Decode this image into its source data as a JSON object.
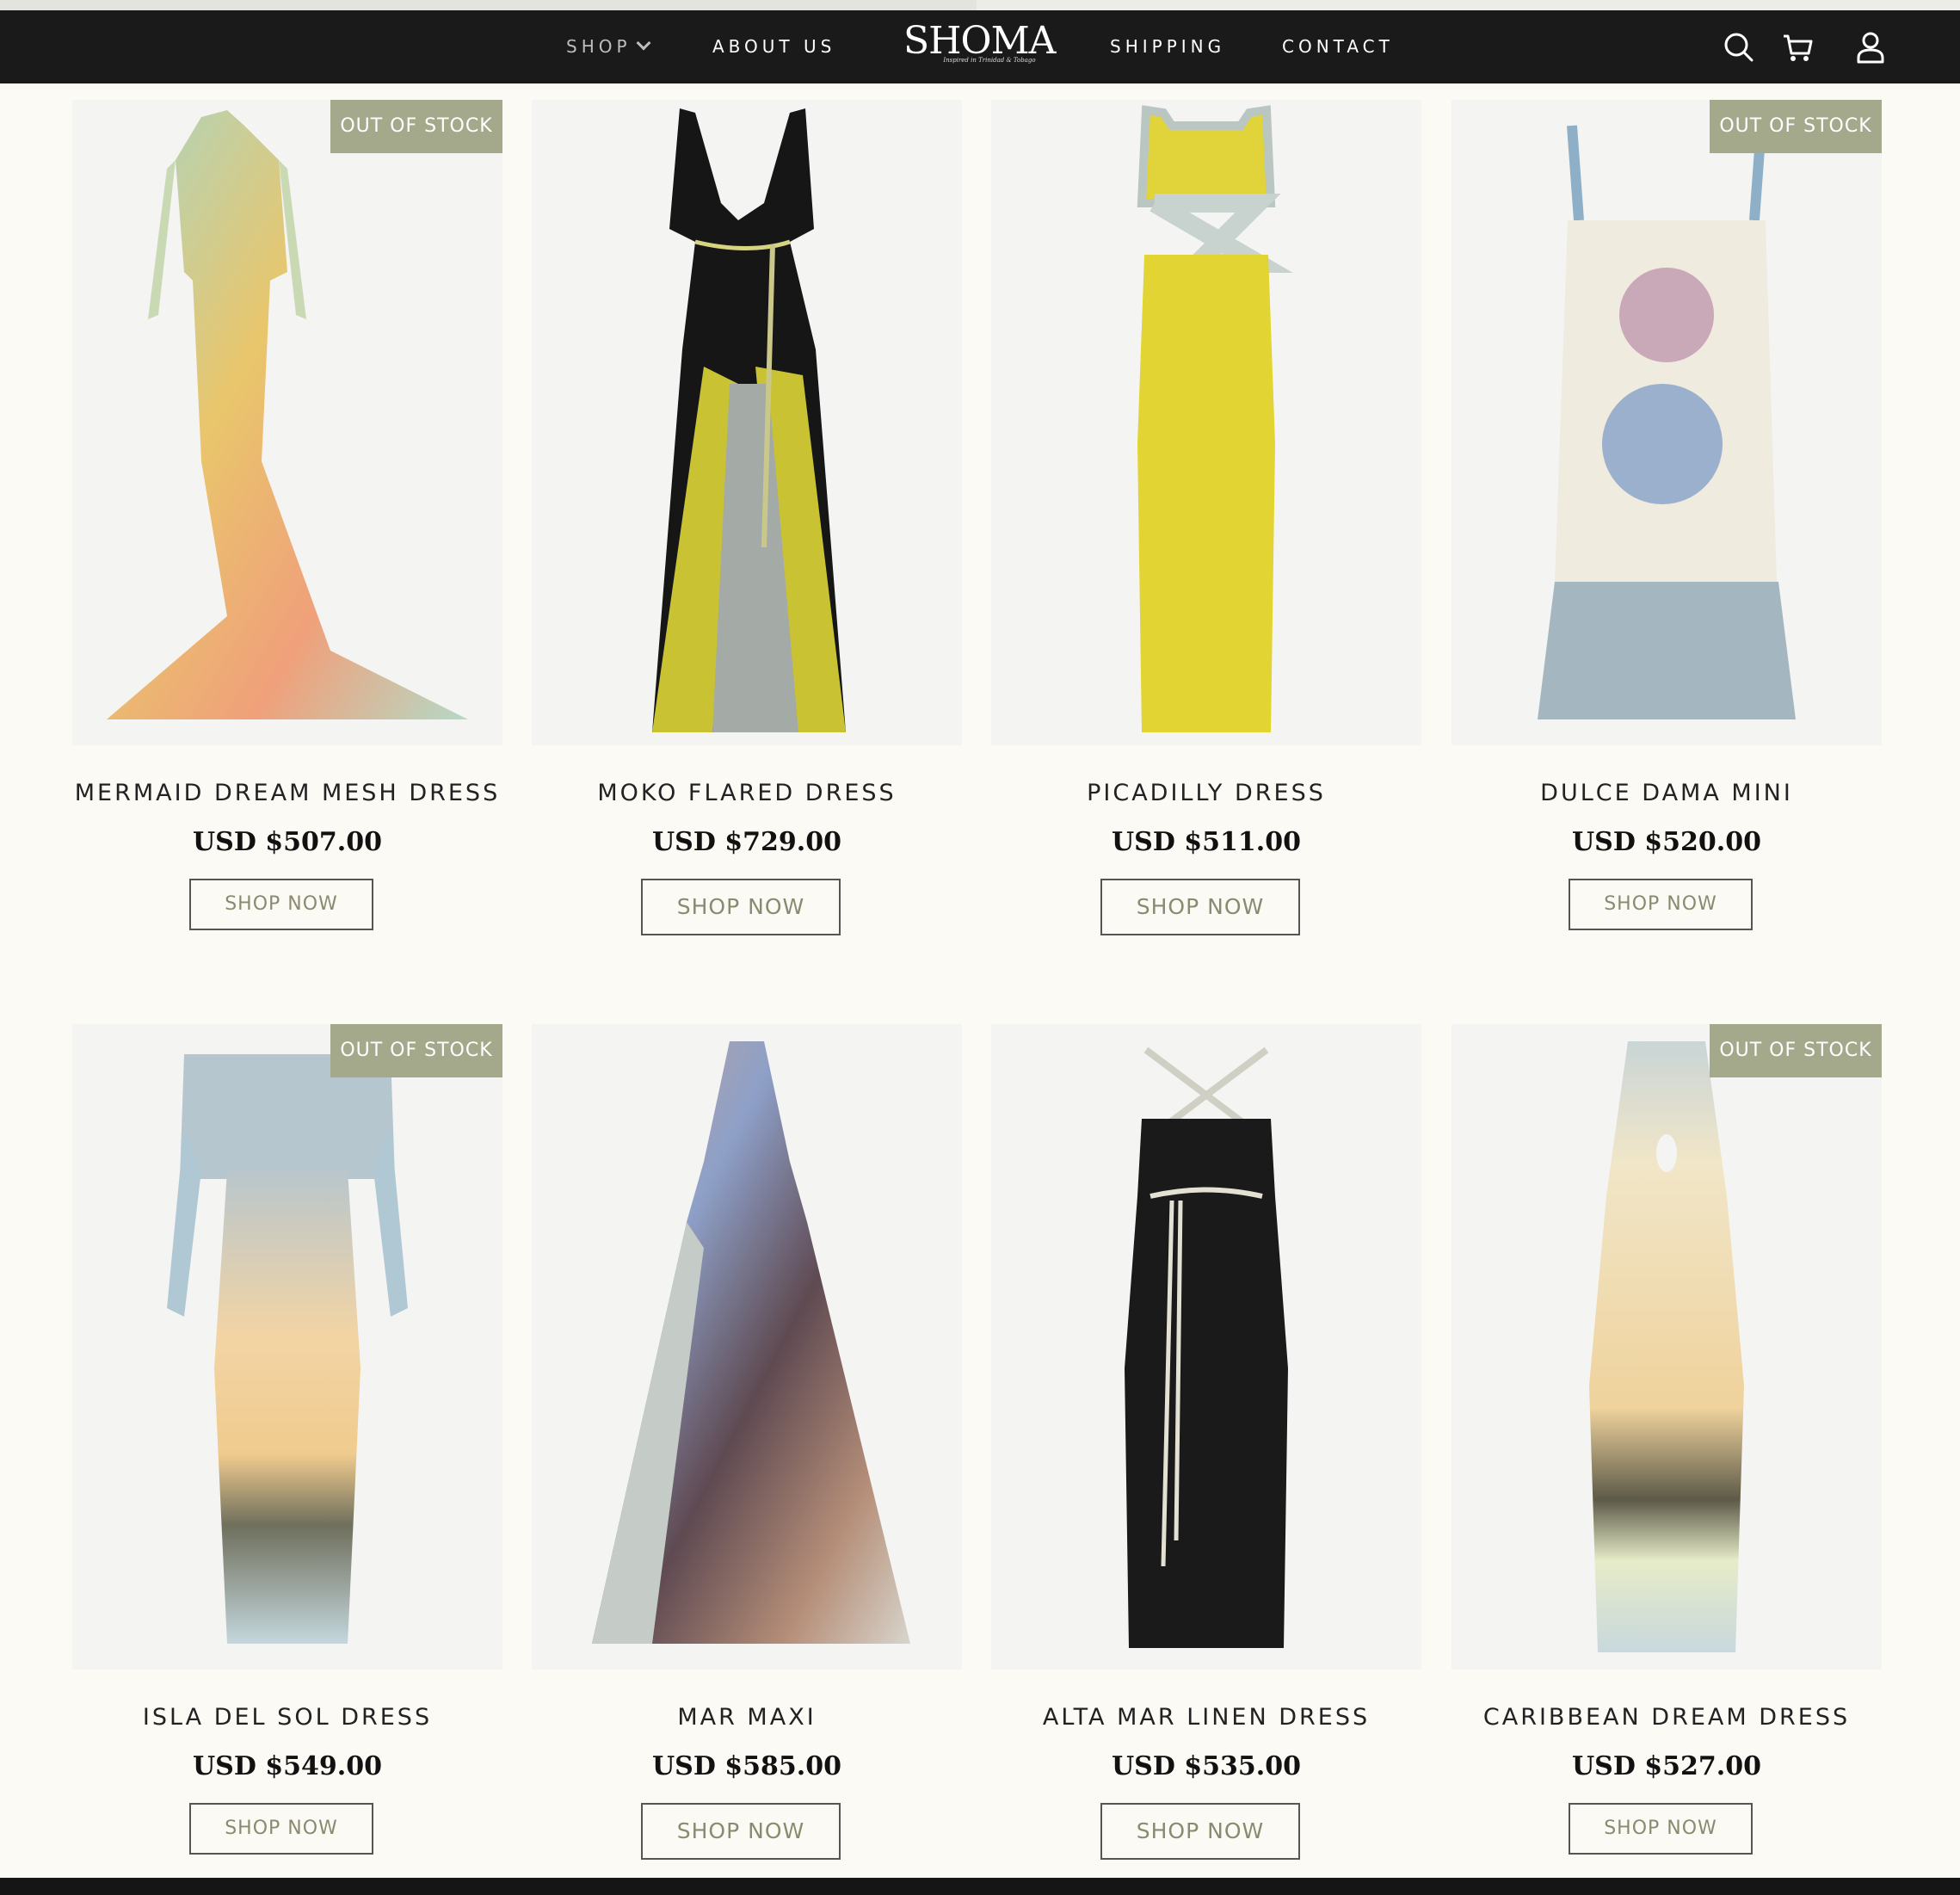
{
  "nav": {
    "shop": "SHOP",
    "about": "ABOUT US",
    "logo": "SHOMA",
    "logo_tagline": "Inspired in Trinidad & Tobago",
    "shipping": "SHIPPING",
    "contact": "CONTACT",
    "icons": [
      "search-icon",
      "cart-icon",
      "user-icon"
    ]
  },
  "colors": {
    "nav_bg": "#1a1a1a",
    "page_bg": "#fcfaf5",
    "badge_bg": "#a5a98b",
    "button_text": "#8a8a70"
  },
  "products": [
    {
      "name": "MERMAID DREAM MESH DRESS",
      "price": "USD $507.00",
      "button": "SHOP NOW",
      "badge": "OUT OF STOCK"
    },
    {
      "name": "MOKO FLARED DRESS",
      "price": "USD $729.00",
      "button": "SHOP NOW",
      "badge": ""
    },
    {
      "name": "PICADILLY DRESS",
      "price": "USD $511.00",
      "button": "SHOP NOW",
      "badge": ""
    },
    {
      "name": "DULCE DAMA MINI",
      "price": "USD $520.00",
      "button": "SHOP NOW",
      "badge": "OUT OF STOCK"
    },
    {
      "name": "ISLA DEL SOL DRESS",
      "price": "USD $549.00",
      "button": "SHOP NOW",
      "badge": "OUT OF STOCK"
    },
    {
      "name": "MAR MAXI",
      "price": "USD $585.00",
      "button": "SHOP NOW",
      "badge": ""
    },
    {
      "name": "ALTA MAR LINEN DRESS",
      "price": "USD $535.00",
      "button": "SHOP NOW",
      "badge": ""
    },
    {
      "name": "CARIBBEAN DREAM DRESS",
      "price": "USD $527.00",
      "button": "SHOP NOW",
      "badge": "OUT OF STOCK"
    }
  ]
}
